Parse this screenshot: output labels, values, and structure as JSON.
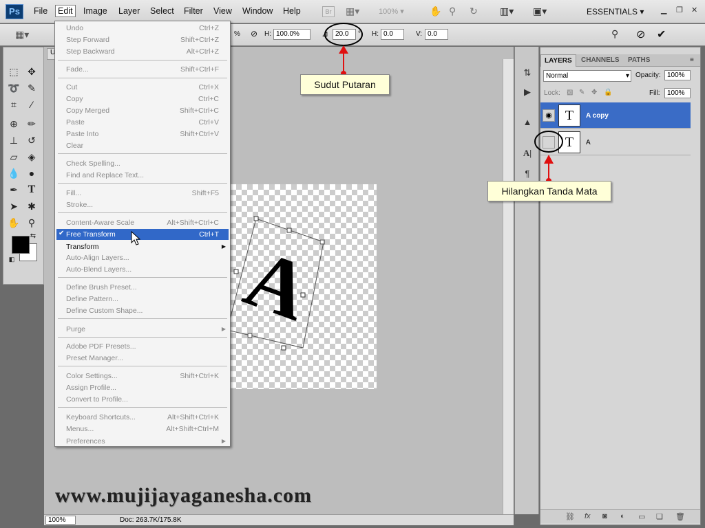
{
  "app": {
    "logo": "Ps"
  },
  "menubar": {
    "items": [
      "File",
      "Edit",
      "Image",
      "Layer",
      "Select",
      "Filter",
      "View",
      "Window",
      "Help"
    ],
    "bridge": "Br",
    "zoom": "100%",
    "workspace": "ESSENTIALS"
  },
  "options": {
    "h_scale": "H: 100.0%",
    "h_scale_value": "100.0%",
    "angle": "20.0",
    "degree": "°",
    "h_skew_label": "H:",
    "h_skew": "0.0",
    "v_skew_label": "V:",
    "v_skew": "0.0",
    "partial": "%"
  },
  "document": {
    "tab": "U",
    "letter": "A",
    "zoom": "100%",
    "doc_info": "Doc: 263.7K/175.8K"
  },
  "edit_menu": {
    "items": [
      {
        "label": "Undo",
        "shortcut": "Ctrl+Z",
        "enabled": false
      },
      {
        "label": "Step Forward",
        "shortcut": "Shift+Ctrl+Z",
        "enabled": false
      },
      {
        "label": "Step Backward",
        "shortcut": "Alt+Ctrl+Z",
        "enabled": false
      },
      {
        "label": "Fade...",
        "shortcut": "Shift+Ctrl+F",
        "enabled": false
      },
      {
        "label": "Cut",
        "shortcut": "Ctrl+X",
        "enabled": false
      },
      {
        "label": "Copy",
        "shortcut": "Ctrl+C",
        "enabled": false
      },
      {
        "label": "Copy Merged",
        "shortcut": "Shift+Ctrl+C",
        "enabled": false
      },
      {
        "label": "Paste",
        "shortcut": "Ctrl+V",
        "enabled": false
      },
      {
        "label": "Paste Into",
        "shortcut": "Shift+Ctrl+V",
        "enabled": false
      },
      {
        "label": "Clear",
        "shortcut": "",
        "enabled": false
      },
      {
        "label": "Check Spelling...",
        "shortcut": "",
        "enabled": false
      },
      {
        "label": "Find and Replace Text...",
        "shortcut": "",
        "enabled": false
      },
      {
        "label": "Fill...",
        "shortcut": "Shift+F5",
        "enabled": false
      },
      {
        "label": "Stroke...",
        "shortcut": "",
        "enabled": false
      },
      {
        "label": "Content-Aware Scale",
        "shortcut": "Alt+Shift+Ctrl+C",
        "enabled": false
      },
      {
        "label": "Free Transform",
        "shortcut": "Ctrl+T",
        "enabled": true
      },
      {
        "label": "Transform",
        "shortcut": "",
        "enabled": true
      },
      {
        "label": "Auto-Align Layers...",
        "shortcut": "",
        "enabled": false
      },
      {
        "label": "Auto-Blend Layers...",
        "shortcut": "",
        "enabled": false
      },
      {
        "label": "Define Brush Preset...",
        "shortcut": "",
        "enabled": false
      },
      {
        "label": "Define Pattern...",
        "shortcut": "",
        "enabled": false
      },
      {
        "label": "Define Custom Shape...",
        "shortcut": "",
        "enabled": false
      },
      {
        "label": "Purge",
        "shortcut": "",
        "enabled": false
      },
      {
        "label": "Adobe PDF Presets...",
        "shortcut": "",
        "enabled": false
      },
      {
        "label": "Preset Manager...",
        "shortcut": "",
        "enabled": false
      },
      {
        "label": "Color Settings...",
        "shortcut": "Shift+Ctrl+K",
        "enabled": false
      },
      {
        "label": "Assign Profile...",
        "shortcut": "",
        "enabled": false
      },
      {
        "label": "Convert to Profile...",
        "shortcut": "",
        "enabled": false
      },
      {
        "label": "Keyboard Shortcuts...",
        "shortcut": "Alt+Shift+Ctrl+K",
        "enabled": false
      },
      {
        "label": "Menus...",
        "shortcut": "Alt+Shift+Ctrl+M",
        "enabled": false
      },
      {
        "label": "Preferences",
        "shortcut": "",
        "enabled": false
      }
    ]
  },
  "layers_panel": {
    "tabs": [
      "LAYERS",
      "CHANNELS",
      "PATHS"
    ],
    "blend_mode": "Normal",
    "opacity_label": "Opacity:",
    "opacity": "100%",
    "lock_label": "Lock:",
    "fill_label": "Fill:",
    "fill": "100%",
    "layers": [
      {
        "name": "A copy",
        "thumb": "T",
        "visible": true,
        "selected": true
      },
      {
        "name": "A",
        "thumb": "T",
        "visible": false,
        "selected": false
      }
    ]
  },
  "callouts": {
    "angle": "Sudut Putaran",
    "eye": "Hilangkan Tanda Mata"
  },
  "watermark": "www.mujijayaganesha.com",
  "colors": {
    "highlight": "#3168c8",
    "callout_bg": "#ffffd8",
    "arrow": "#e01010",
    "canvas_bg": "#bdbdbd"
  }
}
